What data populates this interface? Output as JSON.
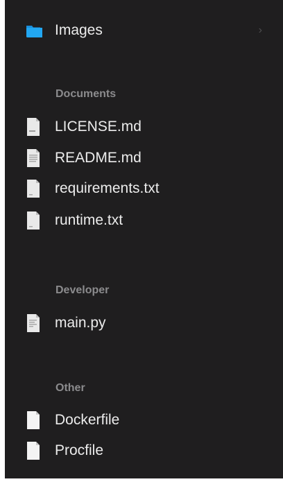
{
  "folder_row": {
    "label": "Images",
    "icon": "folder-icon",
    "chevron": "›",
    "folder_color": "#1ea1f2"
  },
  "sections": [
    {
      "header": "Documents",
      "items": [
        {
          "label": "LICENSE.md",
          "icon": "markdown-file-icon"
        },
        {
          "label": "README.md",
          "icon": "markdown-file-icon"
        },
        {
          "label": "requirements.txt",
          "icon": "text-file-icon"
        },
        {
          "label": "runtime.txt",
          "icon": "text-file-icon"
        }
      ]
    },
    {
      "header": "Developer",
      "items": [
        {
          "label": "main.py",
          "icon": "python-file-icon"
        }
      ]
    },
    {
      "header": "Other",
      "items": [
        {
          "label": "Dockerfile",
          "icon": "file-icon"
        },
        {
          "label": "Procfile",
          "icon": "file-icon"
        }
      ]
    }
  ],
  "colors": {
    "background": "#1f1e1f",
    "text": "#ececec",
    "section_header": "#8b8b8d",
    "chevron": "#4e4e50"
  }
}
